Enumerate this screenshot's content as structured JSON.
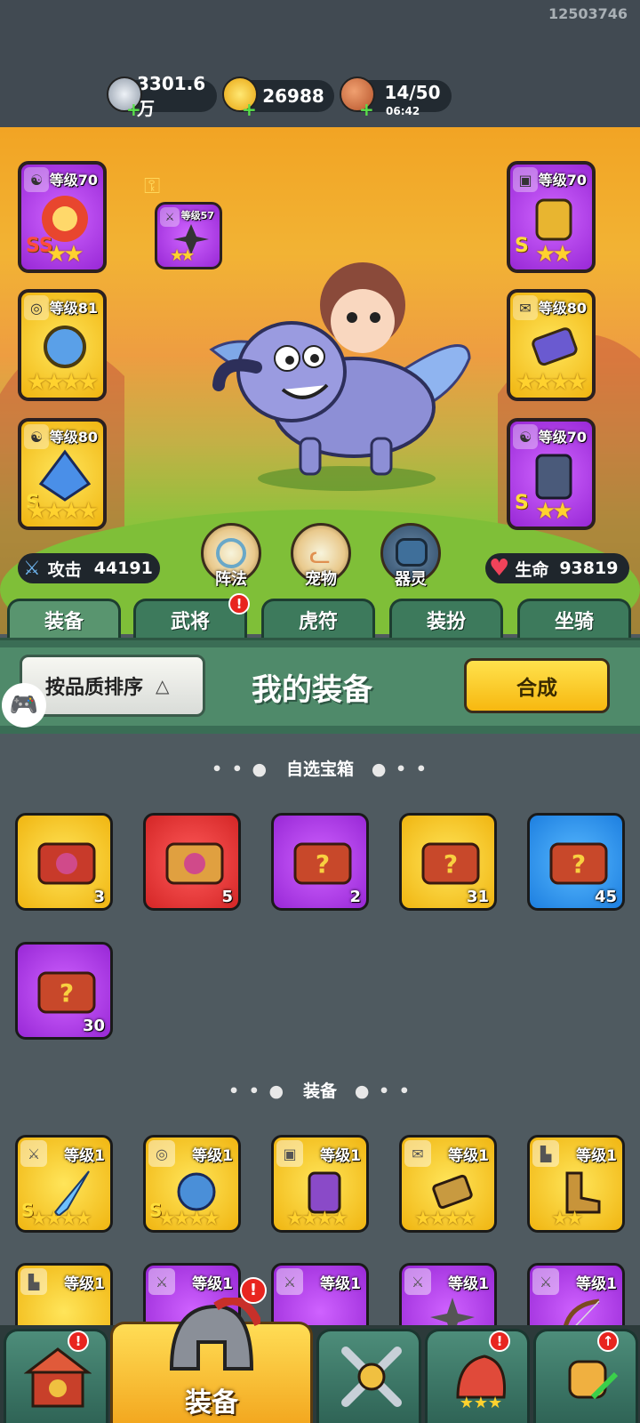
{
  "header": {
    "uid": "12503746",
    "silver": "3301.6万",
    "gold": "26988",
    "stamina": "14/50",
    "stamina_timer": "06:42"
  },
  "hero_slots": {
    "left": [
      {
        "level": "等级70",
        "rarity": "purple",
        "stars": 2,
        "grade": "SS"
      },
      {
        "level": "等级81",
        "rarity": "gold",
        "stars": 4,
        "grade": ""
      },
      {
        "level": "等级80",
        "rarity": "gold",
        "stars": 4,
        "grade": "S"
      }
    ],
    "right": [
      {
        "level": "等级70",
        "rarity": "purple",
        "stars": 2,
        "grade": "S"
      },
      {
        "level": "等级80",
        "rarity": "gold",
        "stars": 4,
        "grade": ""
      },
      {
        "level": "等级70",
        "rarity": "purple",
        "stars": 2,
        "grade": "S"
      }
    ],
    "small": {
      "level": "等级57",
      "stars": 2
    }
  },
  "stats": {
    "attack_label": "攻击",
    "attack_value": "44191",
    "hp_label": "生命",
    "hp_value": "93819"
  },
  "round_buttons": [
    "阵法",
    "宠物",
    "器灵"
  ],
  "tabs": [
    "装备",
    "武将",
    "虎符",
    "装扮",
    "坐骑"
  ],
  "toolbar": {
    "sort_label": "按品质排序",
    "title": "我的装备",
    "synth_label": "合成"
  },
  "chest_section": {
    "title": "自选宝箱",
    "items": [
      {
        "rarity": "gold",
        "count": "3"
      },
      {
        "rarity": "red",
        "count": "5"
      },
      {
        "rarity": "purple",
        "count": "2"
      },
      {
        "rarity": "gold",
        "count": "31"
      },
      {
        "rarity": "blue",
        "count": "45"
      },
      {
        "rarity": "purple",
        "count": "30"
      }
    ]
  },
  "equip_section": {
    "title": "装备",
    "items": [
      {
        "level": "等级1",
        "rarity": "gold",
        "grade": "S",
        "stars": 4
      },
      {
        "level": "等级1",
        "rarity": "gold",
        "grade": "S",
        "stars": 4
      },
      {
        "level": "等级1",
        "rarity": "gold",
        "grade": "",
        "stars": 4
      },
      {
        "level": "等级1",
        "rarity": "gold",
        "grade": "",
        "stars": 4
      },
      {
        "level": "等级1",
        "rarity": "gold",
        "grade": "",
        "stars": 2
      },
      {
        "level": "等级1",
        "rarity": "gold",
        "grade": "",
        "stars": 0
      },
      {
        "level": "等级1",
        "rarity": "purple",
        "grade": "",
        "stars": 0
      },
      {
        "level": "等级1",
        "rarity": "purple",
        "grade": "",
        "stars": 0
      },
      {
        "level": "等级1",
        "rarity": "purple",
        "grade": "",
        "stars": 0
      },
      {
        "level": "等级1",
        "rarity": "purple",
        "grade": "",
        "stars": 0
      }
    ]
  },
  "bottom_nav": {
    "active_label": "装备"
  },
  "colors": {
    "gold_frame": "#f0b511",
    "purple_frame": "#9828d6",
    "red_frame": "#d42626",
    "blue_frame": "#1d7fe0",
    "tab_green": "#3d7a5c",
    "background": "#4f5a60"
  }
}
